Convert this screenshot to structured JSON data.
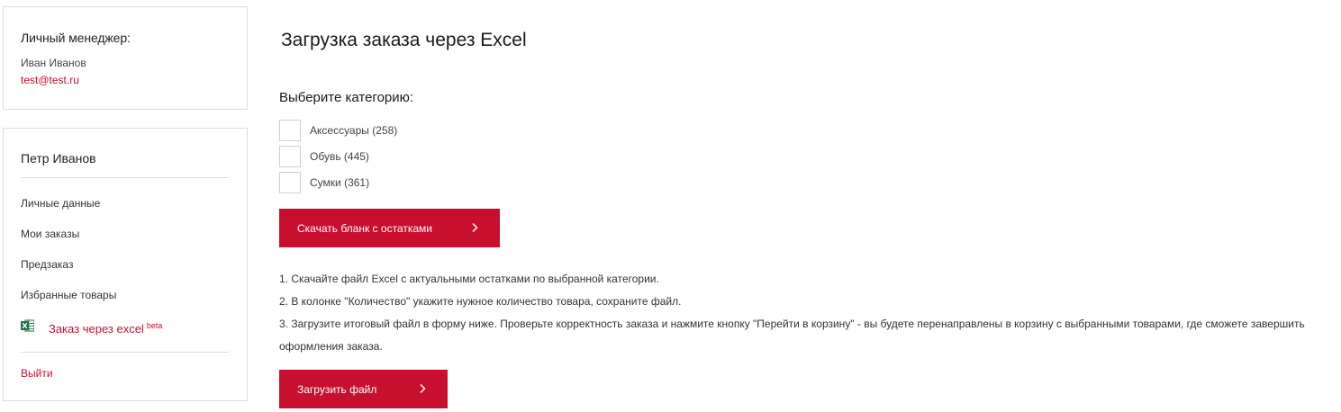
{
  "sidebar": {
    "manager": {
      "title": "Личный менеджер:",
      "name": "Иван Иванов",
      "email": "test@test.ru"
    },
    "user": {
      "name": "Петр Иванов",
      "menu": [
        {
          "label": "Личные данные"
        },
        {
          "label": "Мои заказы"
        },
        {
          "label": "Предзаказ"
        },
        {
          "label": "Избранные товары"
        },
        {
          "label": "Заказ через excel",
          "badge": "beta",
          "icon": "excel-icon"
        }
      ],
      "logout": "Выйти"
    }
  },
  "main": {
    "title": "Загрузка заказа через Excel",
    "category_title": "Выберите категорию:",
    "categories": [
      {
        "label": "Аксессуары (258)",
        "checked": false
      },
      {
        "label": "Обувь (445)",
        "checked": false
      },
      {
        "label": "Сумки (361)",
        "checked": false
      }
    ],
    "download_button": "Скачать бланк с остатками",
    "instructions": [
      "1. Скачайте файл Excel с актуальными остатками по выбранной категории.",
      "2. В колонке \"Количество\" укажите нужное количество товара, сохраните файл.",
      "3. Загрузите итоговый файл в форму ниже. Проверьте корректность заказа и нажмите кнопку \"Перейти в корзину\" - вы будете перенаправлены в корзину с выбранными товарами, где сможете завершить оформления заказа."
    ],
    "upload_button": "Загрузить файл"
  },
  "colors": {
    "accent": "#c8102e",
    "border": "#dcdcdc",
    "excel_green": "#1e7145"
  }
}
